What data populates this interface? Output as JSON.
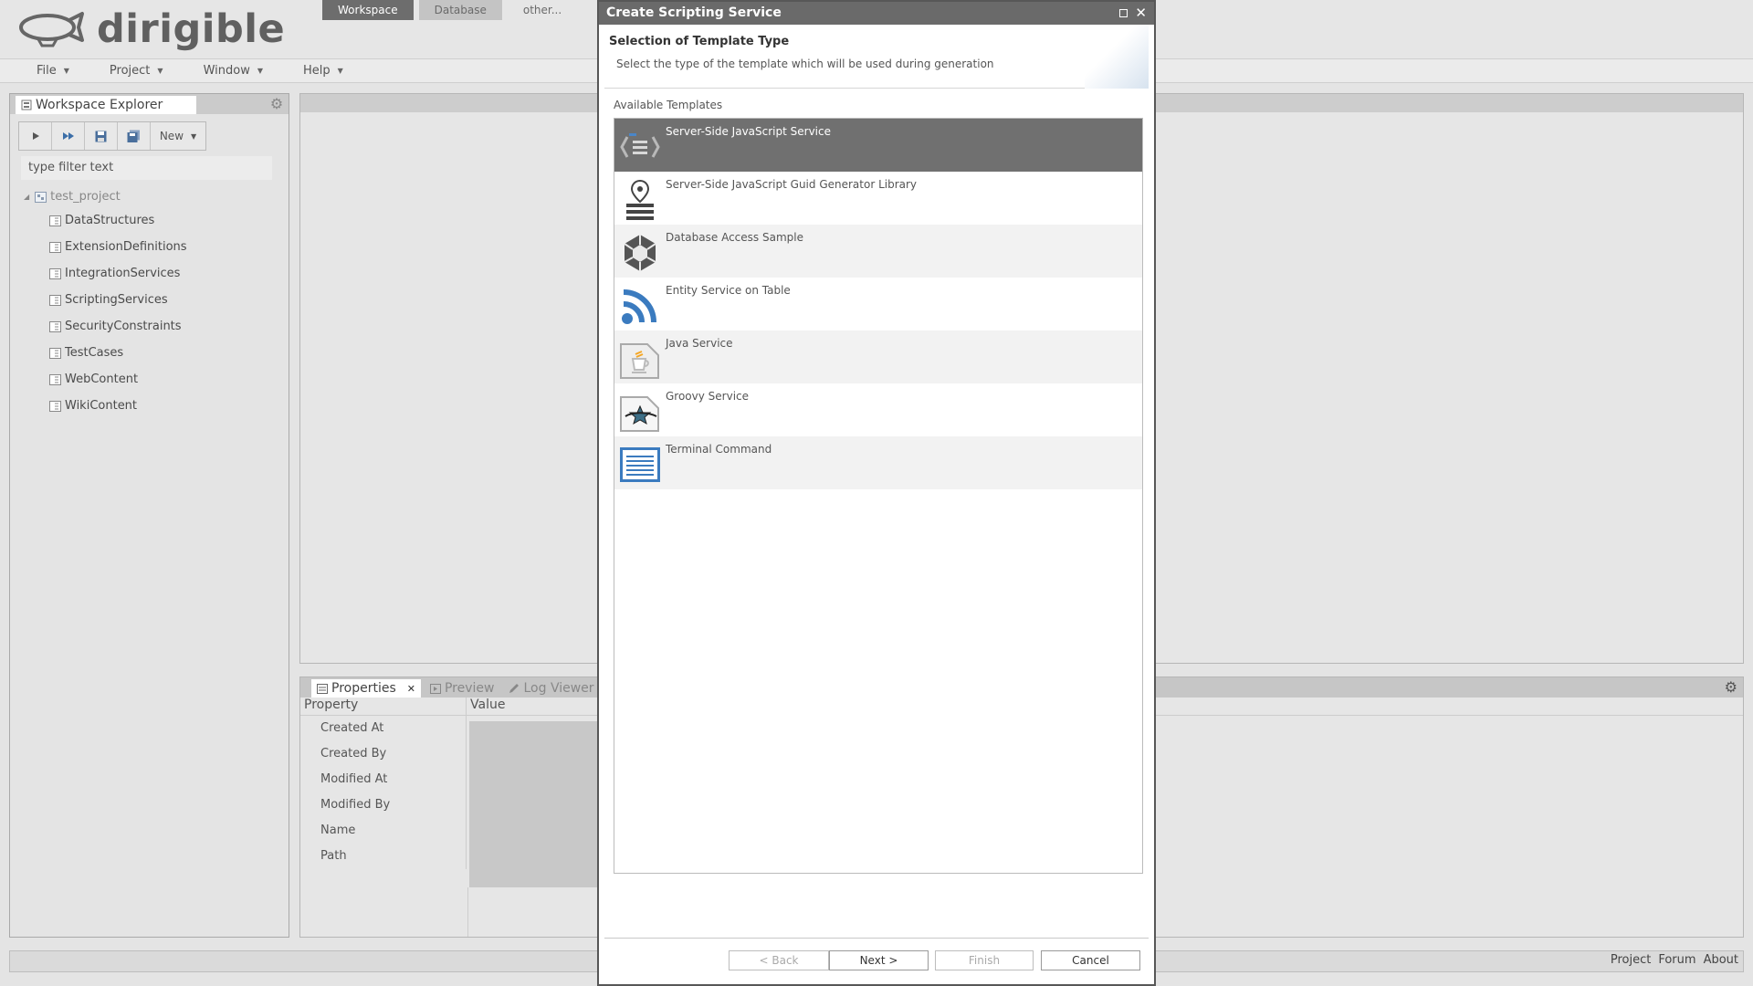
{
  "app": {
    "logo_text": "dirigible"
  },
  "perspectives": [
    {
      "label": "Workspace",
      "state": "active"
    },
    {
      "label": "Database",
      "state": "inactive"
    },
    {
      "label": "other...",
      "state": "plain"
    }
  ],
  "menubar": {
    "file": "File",
    "project": "Project",
    "window": "Window",
    "help": "Help"
  },
  "explorer": {
    "title": "Workspace Explorer",
    "new_label": "New",
    "filter_placeholder": "type filter text",
    "root": "test_project",
    "folders": [
      "DataStructures",
      "ExtensionDefinitions",
      "IntegrationServices",
      "ScriptingServices",
      "SecurityConstraints",
      "TestCases",
      "WebContent",
      "WikiContent"
    ]
  },
  "properties": {
    "tabs": [
      "Properties",
      "Preview",
      "Log Viewer"
    ],
    "col_property": "Property",
    "col_value": "Value",
    "rows": [
      "Created At",
      "Created By",
      "Modified At",
      "Modified By",
      "Name",
      "Path"
    ]
  },
  "status_links": [
    "Project",
    "Forum",
    "About"
  ],
  "dialog": {
    "title": "Create Scripting Service",
    "banner_title": "Selection of Template Type",
    "banner_desc": "Select the type of the template which will be used during generation",
    "list_label": "Available Templates",
    "templates": [
      {
        "name": "Server-Side JavaScript Service",
        "icon": "javascript-service-icon",
        "selected": true
      },
      {
        "name": "Server-Side JavaScript Guid Generator Library",
        "icon": "guid-generator-icon",
        "selected": false
      },
      {
        "name": "Database Access Sample",
        "icon": "database-cube-icon",
        "selected": false
      },
      {
        "name": "Entity Service on Table",
        "icon": "rss-feed-icon",
        "selected": false
      },
      {
        "name": "Java Service",
        "icon": "java-cup-icon",
        "selected": false
      },
      {
        "name": "Groovy Service",
        "icon": "groovy-star-icon",
        "selected": false
      },
      {
        "name": "Terminal Command",
        "icon": "terminal-icon",
        "selected": false
      }
    ],
    "buttons": {
      "back": "< Back",
      "next": "Next >",
      "finish": "Finish",
      "cancel": "Cancel"
    }
  },
  "colors": {
    "accent_blue": "#3b7bbf",
    "selection_grey": "#707070",
    "title_bar": "#6a6a6a"
  }
}
